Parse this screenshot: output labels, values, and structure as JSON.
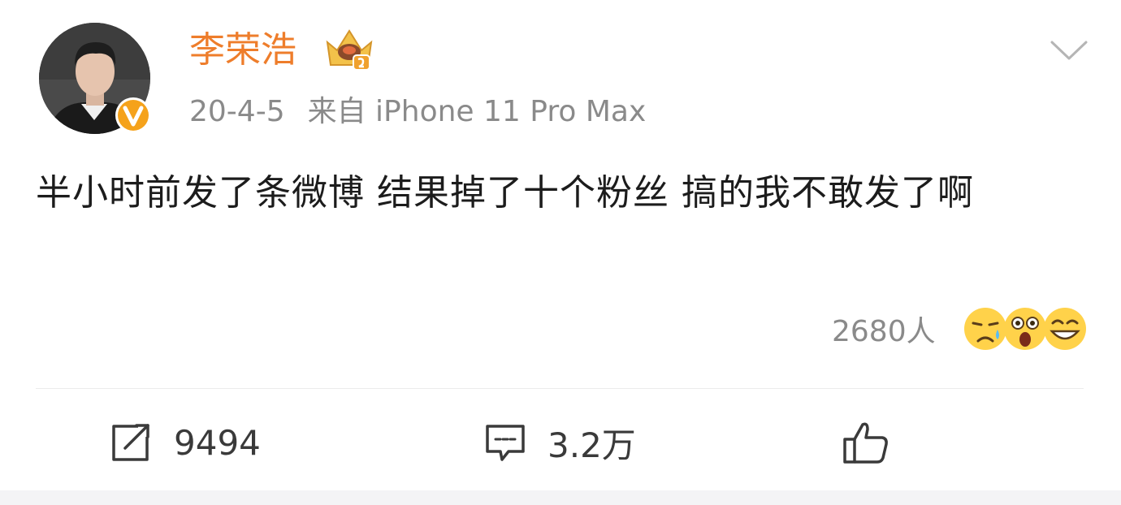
{
  "post": {
    "username": "李荣浩",
    "date": "20-4-5",
    "source": "来自 iPhone 11 Pro Max",
    "text": "半小时前发了条微博 结果掉了十个粉丝 搞的我不敢发了啊",
    "reaction_count": "2680人",
    "reaction_icons": [
      "sad-tear-emoji",
      "shocked-emoji",
      "grin-emoji"
    ]
  },
  "actions": {
    "repost_count": "9494",
    "comment_count": "3.2万"
  },
  "colors": {
    "username": "#ee7d2b",
    "verified_badge": "#f5a21b",
    "meta_text": "#8a8a8a",
    "body_text": "#1c1c1c"
  }
}
